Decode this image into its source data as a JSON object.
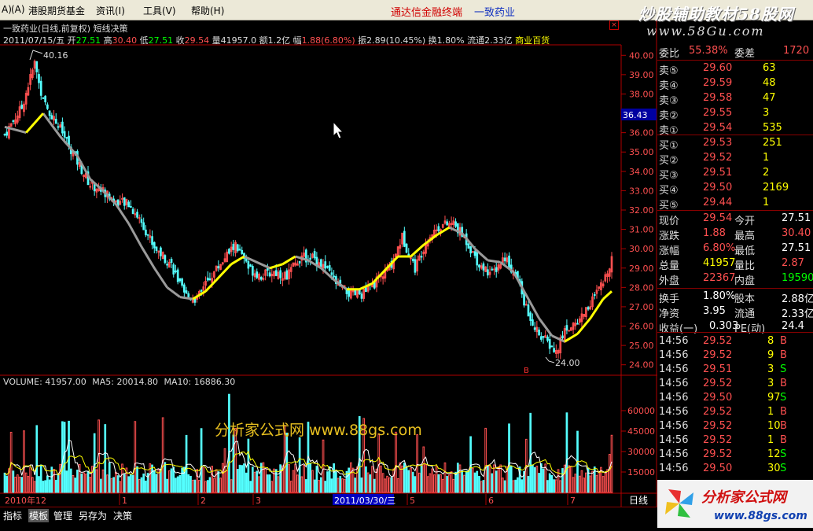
{
  "menu": {
    "left_cut": "A)",
    "left_cut2": "(A)",
    "items": [
      "港股期货基金",
      "资讯(I)",
      "工具(V)",
      "帮助(H)"
    ],
    "banner_left": "通达信金融终端",
    "banner_right": "一致药业",
    "brand": "炒股辅助教材58股网",
    "brand_url": "www.58Gu.com"
  },
  "chart": {
    "title": "一致药业(日线,前复权) 短线决策",
    "close_symbol": "×",
    "quote": {
      "date": "2011/07/15/五",
      "open_label": "开",
      "open": "27.51",
      "high_label": "高",
      "high": "30.40",
      "low_label": "低",
      "low": "27.51",
      "close_label": "收",
      "close": "29.54",
      "vol_label": "量",
      "vol": "41957.0",
      "amt_label": "额",
      "amt": "1.2亿",
      "chg_label": "幅",
      "chg": "1.88(6.80%)",
      "amp_label": "振",
      "amp": "2.89(10.45%)",
      "turn_label": "换",
      "turn": "1.80%",
      "float_label": "流通",
      "float": "2.33亿",
      "sector": "商业百货"
    },
    "price_axis": [
      "40.00",
      "39.00",
      "38.00",
      "37.00",
      "36.00",
      "35.00",
      "34.00",
      "33.00",
      "32.00",
      "31.00",
      "30.00",
      "29.00",
      "28.00",
      "27.00",
      "26.00",
      "25.00",
      "24.00"
    ],
    "current_tag": "36.43",
    "high_mark": "40.16",
    "low_mark": "24.00",
    "marker_b": "B",
    "volume_legend": {
      "vol_label": "VOLUME:",
      "vol": "41957.00",
      "ma5_label": "MA5:",
      "ma5": "20014.80",
      "ma10_label": "MA10:",
      "ma10": "16886.30"
    },
    "volume_axis": [
      "60000",
      "45000",
      "30000",
      "15000"
    ],
    "watermark": "分析家公式网 www.88gs.com",
    "date_axis": [
      {
        "label": "2010年12"
      },
      {
        "label": "1"
      },
      {
        "label": "2"
      },
      {
        "label": "3"
      },
      {
        "label": "2011/03/30/三"
      },
      {
        "label": "5"
      },
      {
        "label": "6"
      },
      {
        "label": "7"
      }
    ],
    "period": "日线"
  },
  "order_book": {
    "ratio": {
      "label1": "委比",
      "value1": "55.38%",
      "label2": "委差",
      "value2": "1720"
    },
    "sell": [
      {
        "label": "卖⑤",
        "price": "29.60",
        "vol": "63"
      },
      {
        "label": "卖④",
        "price": "29.59",
        "vol": "48"
      },
      {
        "label": "卖③",
        "price": "29.58",
        "vol": "47"
      },
      {
        "label": "卖②",
        "price": "29.55",
        "vol": "3"
      },
      {
        "label": "卖①",
        "price": "29.54",
        "vol": "535"
      }
    ],
    "buy": [
      {
        "label": "买①",
        "price": "29.53",
        "vol": "251"
      },
      {
        "label": "买②",
        "price": "29.52",
        "vol": "1"
      },
      {
        "label": "买③",
        "price": "29.51",
        "vol": "2"
      },
      {
        "label": "买④",
        "price": "29.50",
        "vol": "2169"
      },
      {
        "label": "买⑤",
        "price": "29.44",
        "vol": "1"
      }
    ]
  },
  "stats": [
    {
      "l1": "现价",
      "v1": "29.54",
      "c1": "#ff5050",
      "l2": "今开",
      "v2": "27.51",
      "c2": "#ffffff"
    },
    {
      "l1": "涨跌",
      "v1": "1.88",
      "c1": "#ff5050",
      "l2": "最高",
      "v2": "30.40",
      "c2": "#ff5050"
    },
    {
      "l1": "涨幅",
      "v1": "6.80%",
      "c1": "#ff5050",
      "l2": "最低",
      "v2": "27.51",
      "c2": "#ffffff"
    },
    {
      "l1": "总量",
      "v1": "41957",
      "c1": "#ffff00",
      "l2": "量比",
      "v2": "2.87",
      "c2": "#ff5050"
    },
    {
      "l1": "外盘",
      "v1": "22367",
      "c1": "#ff5050",
      "l2": "内盘",
      "v2": "19590",
      "c2": "#00ff00"
    },
    {
      "l1": "换手",
      "v1": "1.80%",
      "c1": "#ffffff",
      "l2": "股本",
      "v2": "2.88亿",
      "c2": "#ffffff"
    },
    {
      "l1": "净资",
      "v1": "3.95",
      "c1": "#ffffff",
      "l2": "流通",
      "v2": "2.33亿",
      "c2": "#ffffff"
    },
    {
      "l1": "收益(一)",
      "v1": "0.303",
      "c1": "#ffffff",
      "l2": "PE(动)",
      "v2": "24.4",
      "c2": "#ffffff"
    }
  ],
  "ticks": [
    {
      "time": "14:56",
      "price": "29.52",
      "vol": "8",
      "dir": "B"
    },
    {
      "time": "14:56",
      "price": "29.52",
      "vol": "9",
      "dir": "B"
    },
    {
      "time": "14:56",
      "price": "29.51",
      "vol": "3",
      "dir": "S"
    },
    {
      "time": "14:56",
      "price": "29.52",
      "vol": "3",
      "dir": "B"
    },
    {
      "time": "14:56",
      "price": "29.50",
      "vol": "97",
      "dir": "S"
    },
    {
      "time": "14:56",
      "price": "29.52",
      "vol": "1",
      "dir": "B"
    },
    {
      "time": "14:56",
      "price": "29.52",
      "vol": "10",
      "dir": "B"
    },
    {
      "time": "14:56",
      "price": "29.52",
      "vol": "1",
      "dir": "B"
    },
    {
      "time": "14:56",
      "price": "29.52",
      "vol": "12",
      "dir": "S"
    },
    {
      "time": "14:56",
      "price": "29.50",
      "vol": "30",
      "dir": "S"
    }
  ],
  "bottom_bar": [
    "指标",
    "模板",
    "管理",
    "另存为",
    "决策"
  ],
  "brand_bottom": {
    "name": "分析家公式网",
    "url": "www.88gs.com"
  },
  "colors": {
    "up": "#ff5050",
    "down": "#54ffff",
    "ma_gray": "#9a9a9a",
    "ma_yellow": "#ffff00",
    "frame": "#b00000"
  },
  "chart_data": {
    "type": "candlestick",
    "title": "一致药业(日线,前复权) 短线决策",
    "ylim": [
      23.5,
      40.5
    ],
    "y_ticks": [
      24,
      25,
      26,
      27,
      28,
      29,
      30,
      31,
      32,
      33,
      34,
      35,
      36,
      37,
      38,
      39,
      40
    ],
    "volume_ylim": [
      0,
      75000
    ],
    "volume_ticks": [
      15000,
      30000,
      45000,
      60000
    ],
    "high_annotation": 40.16,
    "low_annotation": 24.0,
    "summary": {
      "open": 27.51,
      "high": 30.4,
      "low": 27.51,
      "close": 29.54,
      "volume": 41957.0,
      "vol_ma5": 20014.8,
      "vol_ma10": 16886.3
    },
    "close_path": [
      [
        0,
        35.9
      ],
      [
        8,
        37.3
      ],
      [
        14,
        39.6
      ],
      [
        18,
        37.6
      ],
      [
        26,
        36.2
      ],
      [
        34,
        34.5
      ],
      [
        40,
        33.3
      ],
      [
        46,
        33.0
      ],
      [
        52,
        32.4
      ],
      [
        58,
        32.3
      ],
      [
        64,
        31.4
      ],
      [
        70,
        30.1
      ],
      [
        78,
        29.2
      ],
      [
        84,
        27.6
      ],
      [
        90,
        27.4
      ],
      [
        96,
        28.5
      ],
      [
        102,
        29.4
      ],
      [
        108,
        30.2
      ],
      [
        114,
        29.0
      ],
      [
        120,
        28.6
      ],
      [
        126,
        28.8
      ],
      [
        132,
        28.6
      ],
      [
        138,
        29.5
      ],
      [
        144,
        29.6
      ],
      [
        150,
        29.0
      ],
      [
        156,
        28.1
      ],
      [
        162,
        27.6
      ],
      [
        168,
        27.7
      ],
      [
        174,
        28.3
      ],
      [
        180,
        29.0
      ],
      [
        186,
        30.6
      ],
      [
        192,
        29.0
      ],
      [
        198,
        30.6
      ],
      [
        204,
        31.2
      ],
      [
        210,
        31.3
      ],
      [
        216,
        30.4
      ],
      [
        222,
        29.2
      ],
      [
        228,
        28.7
      ],
      [
        234,
        29.6
      ],
      [
        240,
        28.4
      ],
      [
        246,
        26.2
      ],
      [
        252,
        25.4
      ],
      [
        258,
        24.6
      ],
      [
        262,
        25.8
      ],
      [
        268,
        26.2
      ],
      [
        274,
        27.2
      ],
      [
        280,
        28.2
      ],
      [
        284,
        29.54
      ]
    ],
    "trend_line": [
      [
        0,
        36.3
      ],
      [
        10,
        36.0
      ],
      [
        18,
        37.0
      ],
      [
        26,
        35.8
      ],
      [
        34,
        34.8
      ],
      [
        40,
        33.6
      ],
      [
        46,
        33.0
      ],
      [
        52,
        32.3
      ],
      [
        58,
        31.3
      ],
      [
        64,
        30.1
      ],
      [
        70,
        29.0
      ],
      [
        76,
        28.0
      ],
      [
        82,
        27.5
      ],
      [
        88,
        27.4
      ],
      [
        94,
        27.8
      ],
      [
        100,
        28.5
      ],
      [
        106,
        29.2
      ],
      [
        112,
        29.6
      ],
      [
        118,
        29.3
      ],
      [
        124,
        29.0
      ],
      [
        130,
        29.2
      ],
      [
        136,
        29.6
      ],
      [
        142,
        29.4
      ],
      [
        148,
        29.0
      ],
      [
        154,
        28.4
      ],
      [
        160,
        27.9
      ],
      [
        166,
        27.9
      ],
      [
        172,
        28.2
      ],
      [
        178,
        28.9
      ],
      [
        184,
        29.6
      ],
      [
        190,
        29.6
      ],
      [
        196,
        30.2
      ],
      [
        202,
        30.7
      ],
      [
        208,
        31.1
      ],
      [
        214,
        30.8
      ],
      [
        220,
        30.0
      ],
      [
        226,
        29.4
      ],
      [
        232,
        29.3
      ],
      [
        238,
        28.8
      ],
      [
        244,
        27.6
      ],
      [
        250,
        26.4
      ],
      [
        256,
        25.5
      ],
      [
        262,
        25.2
      ],
      [
        268,
        25.6
      ],
      [
        274,
        26.4
      ],
      [
        280,
        27.4
      ],
      [
        284,
        27.8
      ]
    ],
    "x_count": 285
  }
}
